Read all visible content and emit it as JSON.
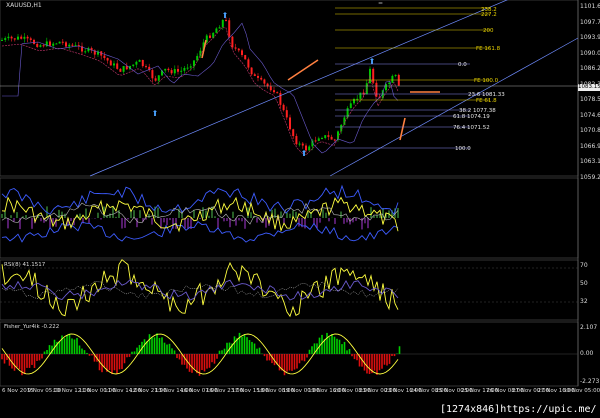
{
  "window": {
    "symbol_title": "XAUUSD,H1",
    "top_marker": "="
  },
  "price_axis": {
    "labels": [
      "1101.60",
      "1097.75",
      "1093.90",
      "1090.05",
      "1086.20",
      "1082.35",
      "1078.50",
      "1074.65",
      "1070.80",
      "1066.95",
      "1063.10",
      "1059.25"
    ],
    "current_price": "1083.15"
  },
  "fibo_labels": [
    {
      "text": "238.2"
    },
    {
      "text": "227.2"
    },
    {
      "text": "200"
    },
    {
      "text": "FE 161.8"
    },
    {
      "text": "0.0"
    },
    {
      "text": "FE 100.0"
    },
    {
      "text": "23.6 1081.33"
    },
    {
      "text": "FE 61.8"
    },
    {
      "text": "38.2 1077.38"
    },
    {
      "text": "61.8 1074.19"
    },
    {
      "text": "76.4 1071.52"
    },
    {
      "text": "100.0"
    }
  ],
  "panels": {
    "rsi_label": "RSI(8) 41.1517",
    "rsi_levels": [
      "70",
      "50",
      "32"
    ],
    "fisher_label": "Fisher_Yur4ik -0.222",
    "fisher_levels": [
      "2.107",
      "0.00",
      "-2.273"
    ]
  },
  "time_axis": [
    "6 Nov 2015",
    "9 Nov 05:00",
    "10 Nov 12:00",
    "11 Nov 00:00",
    "11 Nov 14:00",
    "12 Nov 21:00",
    "13 Nov 14:00",
    "16 Nov 07:00",
    "16 Nov 23:00",
    "17 Nov 15:00",
    "18 Nov 08:00",
    "19 Nov 00:00",
    "19 Nov 16:00",
    "20 Nov 08:00",
    "23 Nov 00:00",
    "23 Nov 16:00",
    "24 Nov 08:00",
    "25 Nov 00:00",
    "25 Nov 17:00",
    "26 Nov 08:00",
    "27 Nov 00:00",
    "27 Nov 16:00",
    "30 Nov 05:00"
  ],
  "watermark": "[1274x846]https://upic.me/",
  "colors": {
    "background": "#000000",
    "bull": "#00c800",
    "bear": "#ff2020",
    "fibo": "#e8d200",
    "trend": "#6f8cff",
    "arrow": "#ff8040",
    "signal": "#ffff40"
  }
}
